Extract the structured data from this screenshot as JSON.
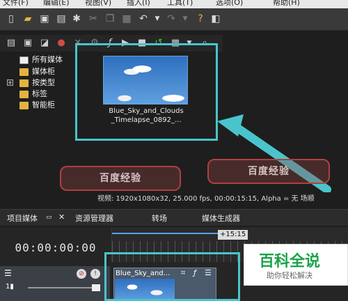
{
  "menu": [
    "文件(F)",
    "编辑(E)",
    "视图(V)",
    "插入(I)",
    "工具(T)",
    "选项(O)",
    "帮助(H)"
  ],
  "toolbar_icons": [
    "new-file-icon",
    "open-folder-icon",
    "save-icon",
    "properties-icon",
    "settings-gear-icon",
    "cut-icon",
    "copy-icon",
    "paste-icon",
    "undo-icon",
    "redo-icon",
    "help-icon"
  ],
  "explorer": {
    "tree": [
      {
        "label": "所有媒体"
      },
      {
        "label": "媒体柜"
      },
      {
        "label": "按类型"
      },
      {
        "label": "标签"
      },
      {
        "label": "智能柜"
      }
    ],
    "media_item": {
      "name_line1": "Blue_Sky_and_Clouds",
      "name_line2": "_Timelapse_0892_..."
    },
    "status": "视频: 1920x1080x32, 25.000 fps, 00:00:15:15, Alpha = 无  场顺"
  },
  "watermarks": [
    "百度经验",
    "百度经验"
  ],
  "tabs": [
    "项目媒体",
    "资源管理器",
    "转场",
    "媒体生成器"
  ],
  "timeline": {
    "timecode": "00:00:00:00",
    "ruler_marker": "+15:15",
    "clip_name": "Blue_Sky_and..."
  },
  "badge": {
    "title": "百科全说",
    "subtitle": "助你轻松解决"
  },
  "colors": {
    "highlight": "#4ac4cc",
    "badge_green": "#1aa34a",
    "folder": "#e3b341"
  }
}
